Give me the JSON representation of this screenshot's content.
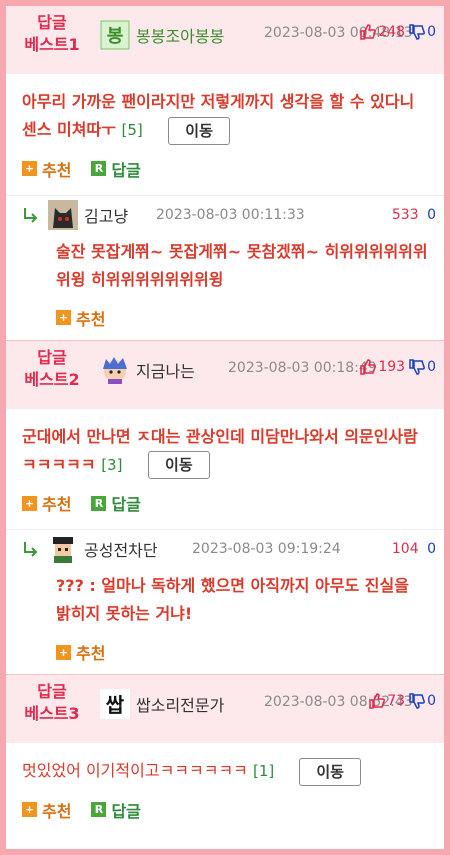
{
  "best_items": [
    {
      "badge_line1": "답글",
      "badge_line2": "베스트1",
      "author": "봉봉조아봉봉",
      "date": "2023-08-03 00:48:13",
      "up_votes": "248",
      "down_votes": "0",
      "content": "아무리 가까운 팬이라지만 저렇게까지 생각을 할 수 있다니 센스 미쳐따ㅜ",
      "reply_count": "[5]",
      "move_label": "이동",
      "recommend_label": "추천",
      "reply_label": "답글",
      "reply": {
        "author": "김고냥",
        "date": "2023-08-03 00:11:33",
        "up_votes": "533",
        "down_votes": "0",
        "content": "술잔 못잡게쮜~ 못잡게쮜~ 못참겠쮜~ 히위위위위위위위윙 히위위위위위위위윙",
        "recommend_label": "추천"
      }
    },
    {
      "badge_line1": "답글",
      "badge_line2": "베스트2",
      "author": "지금나는",
      "date": "2023-08-03 00:18:49",
      "up_votes": "193",
      "down_votes": "0",
      "content": "군대에서 만나면 ㅈ대는 관상인데 미담만나와서 의문인사람 ㅋㅋㅋㅋㅋ",
      "reply_count": "[3]",
      "move_label": "이동",
      "recommend_label": "추천",
      "reply_label": "답글",
      "reply": {
        "author": "공성전차단",
        "date": "2023-08-03 09:19:24",
        "up_votes": "104",
        "down_votes": "0",
        "content": "??? : 얼마나 독하게 했으면 아직까지 아무도 진실을 밝히지 못하는 거냐!",
        "recommend_label": "추천"
      }
    },
    {
      "badge_line1": "답글",
      "badge_line2": "베스트3",
      "author": "쌉소리전문가",
      "date": "2023-08-03 08:52:43",
      "up_votes": "73",
      "down_votes": "0",
      "content": "멋있었어 이기적이고ㅋㅋㅋㅋㅋㅋ",
      "reply_count": "[1]",
      "move_label": "이동",
      "recommend_label": "추천",
      "reply_label": "답글"
    }
  ],
  "colors": {
    "frame": "#f6a8ae",
    "badge": "#e02a4f",
    "content": "#d93a2b",
    "recommend": "#d8700f",
    "reply": "#2e8b3a",
    "down_vote": "#1a3fc0"
  }
}
